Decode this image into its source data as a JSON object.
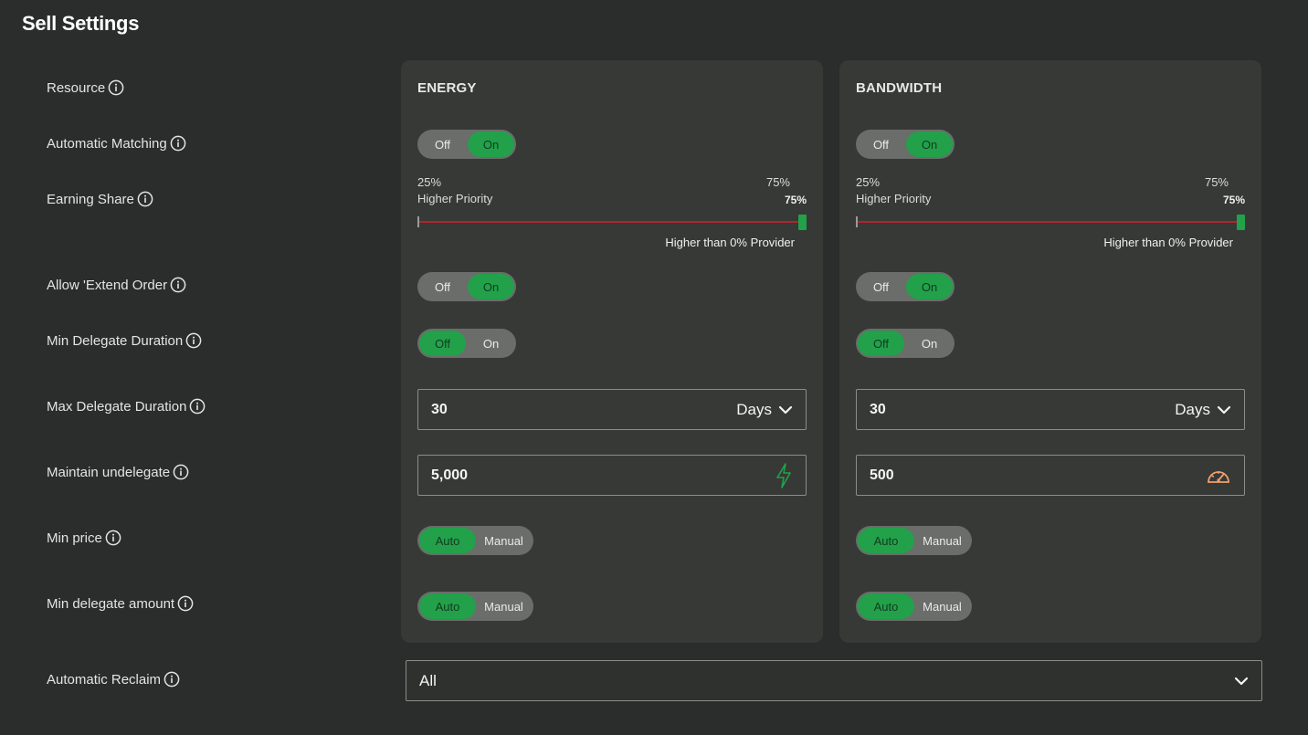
{
  "title": "Sell Settings",
  "labels": {
    "resource": "Resource",
    "automatic_matching": "Automatic Matching",
    "earning_share": "Earning Share",
    "allow_extend_order": "Allow 'Extend Order",
    "min_delegate_duration": "Min Delegate Duration",
    "max_delegate_duration": "Max Delegate Duration",
    "maintain_undelegate": "Maintain undelegate",
    "min_price": "Min price",
    "min_delegate_amount": "Min delegate amount",
    "automatic_reclaim": "Automatic Reclaim"
  },
  "toggle_labels": {
    "off": "Off",
    "on": "On",
    "auto": "Auto",
    "manual": "Manual"
  },
  "energy": {
    "name": "ENERGY",
    "automatic_matching": "On",
    "earning_share": {
      "min_label": "25%",
      "max_label": "75%",
      "priority_label": "Higher Priority",
      "value_label": "75%",
      "value": 75,
      "note": "Higher than 0% Provider"
    },
    "allow_extend_order": "On",
    "min_delegate_duration": "Off",
    "max_delegate_duration": {
      "value": "30",
      "unit": "Days"
    },
    "maintain_undelegate": {
      "value": "5,000",
      "icon": "lightning-icon"
    },
    "min_price": "Auto",
    "min_delegate_amount": "Auto"
  },
  "bandwidth": {
    "name": "BANDWIDTH",
    "automatic_matching": "On",
    "earning_share": {
      "min_label": "25%",
      "max_label": "75%",
      "priority_label": "Higher Priority",
      "value_label": "75%",
      "value": 75,
      "note": "Higher than 0% Provider"
    },
    "allow_extend_order": "On",
    "min_delegate_duration": "Off",
    "max_delegate_duration": {
      "value": "30",
      "unit": "Days"
    },
    "maintain_undelegate": {
      "value": "500",
      "icon": "speedometer-icon"
    },
    "min_price": "Auto",
    "min_delegate_amount": "Auto"
  },
  "automatic_reclaim": {
    "value": "All"
  },
  "colors": {
    "background": "#2a2d2b",
    "card": "#363936",
    "accent_green": "#22a14a",
    "slider_track": "#b3242a",
    "speedometer": "#f0a070"
  }
}
